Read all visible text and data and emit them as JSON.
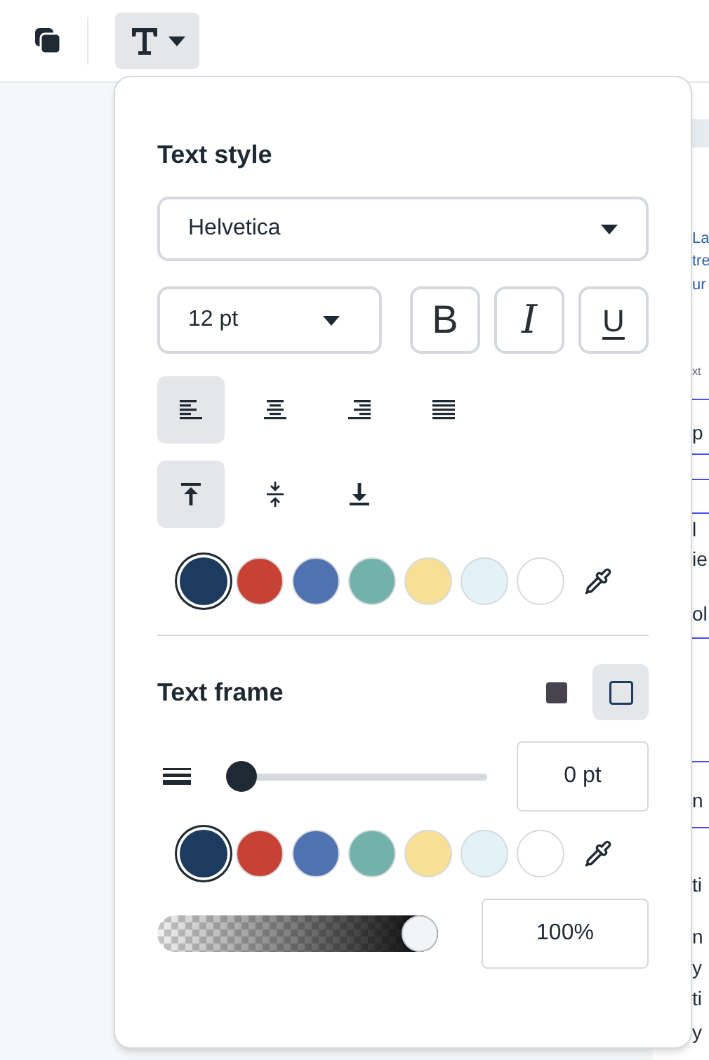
{
  "toolbar": {
    "buttons": [
      {
        "kind": "layers",
        "selected": false
      },
      {
        "kind": "text",
        "selected": true
      }
    ]
  },
  "text_style": {
    "title": "Text style",
    "font": "Helvetica",
    "size": "12 pt",
    "format_buttons": [
      {
        "kind": "bold",
        "label": "B",
        "selected": false
      },
      {
        "kind": "italic",
        "label": "I",
        "selected": false
      },
      {
        "kind": "underline",
        "label": "U",
        "selected": false
      }
    ],
    "align": [
      {
        "kind": "left",
        "selected": true
      },
      {
        "kind": "center",
        "selected": false
      },
      {
        "kind": "right",
        "selected": false
      },
      {
        "kind": "justify",
        "selected": false
      }
    ],
    "valign": [
      {
        "kind": "top",
        "selected": true
      },
      {
        "kind": "middle",
        "selected": false
      },
      {
        "kind": "bottom",
        "selected": false
      }
    ],
    "colors": [
      {
        "color": "#1d3a5f",
        "selected": true
      },
      {
        "color": "#c84233",
        "selected": false
      },
      {
        "color": "#5072b0",
        "selected": false
      },
      {
        "color": "#72b2aa",
        "selected": false
      },
      {
        "color": "#f7df95",
        "selected": false
      },
      {
        "color": "#e2f2f7",
        "selected": false
      },
      {
        "color": "#ffffff",
        "selected": false
      }
    ]
  },
  "text_frame": {
    "title": "Text frame",
    "modes": [
      {
        "kind": "filled",
        "selected": false
      },
      {
        "kind": "outline",
        "selected": true
      }
    ],
    "width": {
      "level": 0,
      "value": "0 pt"
    },
    "colors": [
      {
        "color": "#1d3a5f",
        "selected": true
      },
      {
        "color": "#c84233",
        "selected": false
      },
      {
        "color": "#5072b0",
        "selected": false
      },
      {
        "color": "#72b2aa",
        "selected": false
      },
      {
        "color": "#f7df95",
        "selected": false
      },
      {
        "color": "#e2f2f7",
        "selected": false
      },
      {
        "color": "#ffffff",
        "selected": false
      }
    ],
    "opacity": {
      "level": 1,
      "value": "100%"
    }
  },
  "background_text": [
    {
      "text": "La",
      "kind": "link"
    },
    {
      "text": "tre",
      "kind": "link"
    },
    {
      "text": "ur",
      "kind": "link"
    },
    {
      "text": "xt",
      "kind": "hint"
    },
    {
      "text": "p",
      "kind": "body"
    },
    {
      "text": "l",
      "kind": "body"
    },
    {
      "text": "ie",
      "kind": "body"
    },
    {
      "text": "ol",
      "kind": "body"
    },
    {
      "text": "n",
      "kind": "body"
    },
    {
      "text": "ti",
      "kind": "body"
    },
    {
      "text": "n",
      "kind": "body"
    },
    {
      "text": "y",
      "kind": "body"
    },
    {
      "text": "ti",
      "kind": "body"
    },
    {
      "text": "y",
      "kind": "body"
    }
  ]
}
